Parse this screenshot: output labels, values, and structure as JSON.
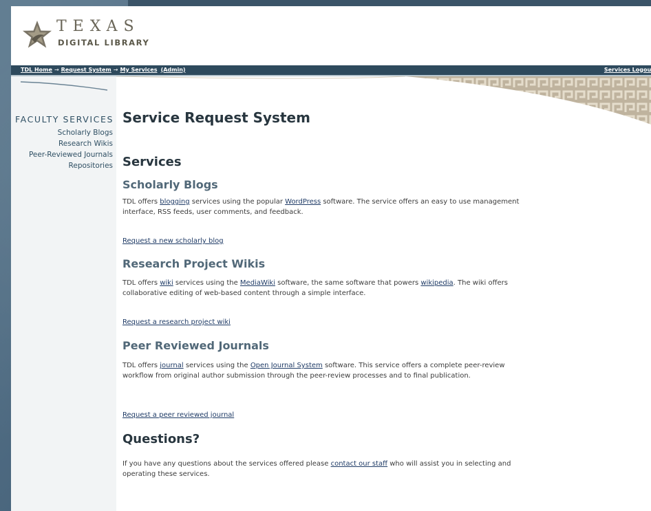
{
  "header": {
    "brand_name": "TEXAS",
    "brand_sub": "DIGITAL LIBRARY"
  },
  "nav": {
    "crumbs": [
      "TDL Home",
      "Request System",
      "My Services",
      "(Admin)"
    ],
    "arrow": "→",
    "logout": "Services Logout"
  },
  "sidebar": {
    "title": "FACULTY SERVICES",
    "items": [
      "Scholarly Blogs",
      "Research Wikis",
      "Peer-Reviewed Journals",
      "Repositories"
    ]
  },
  "main": {
    "title": "Service Request System",
    "services_heading": "Services",
    "blogs": {
      "heading": "Scholarly Blogs",
      "text_1": "TDL offers ",
      "link_1": "blogging",
      "text_2": " services using the popular ",
      "link_2": "WordPress",
      "text_3": " software. The service offers an easy to use management interface, RSS feeds, user comments, and feedback.",
      "request": "Request a new scholarly blog"
    },
    "wikis": {
      "heading": "Research Project Wikis",
      "text_1": "TDL offers ",
      "link_1": "wiki",
      "text_2": " services using the ",
      "link_2": "MediaWiki",
      "text_3": " software, the same software that powers ",
      "link_3": "wikipedia",
      "text_4": ". The wiki offers collaborative editing of web-based content through a simple interface.",
      "request": "Request a research project wiki"
    },
    "journals": {
      "heading": "Peer Reviewed Journals",
      "text_1": "TDL offers ",
      "link_1": "journal",
      "text_2": " services using the ",
      "link_2": "Open Journal System",
      "text_3": " software. This service offers a complete peer-review workflow from original author submission through the peer-review processes and to final publication.",
      "request": "Request a peer reviewed journal"
    },
    "questions": {
      "heading": "Questions?",
      "text_1": "If you have any questions about the services offered please ",
      "link": "contact our staff",
      "text_2": " who will assist you in selecting and operating these services."
    }
  },
  "colors": {
    "navbar": "#2e4a5d",
    "sidebar_bg": "#f2f4f5",
    "link": "#1f3b66"
  }
}
